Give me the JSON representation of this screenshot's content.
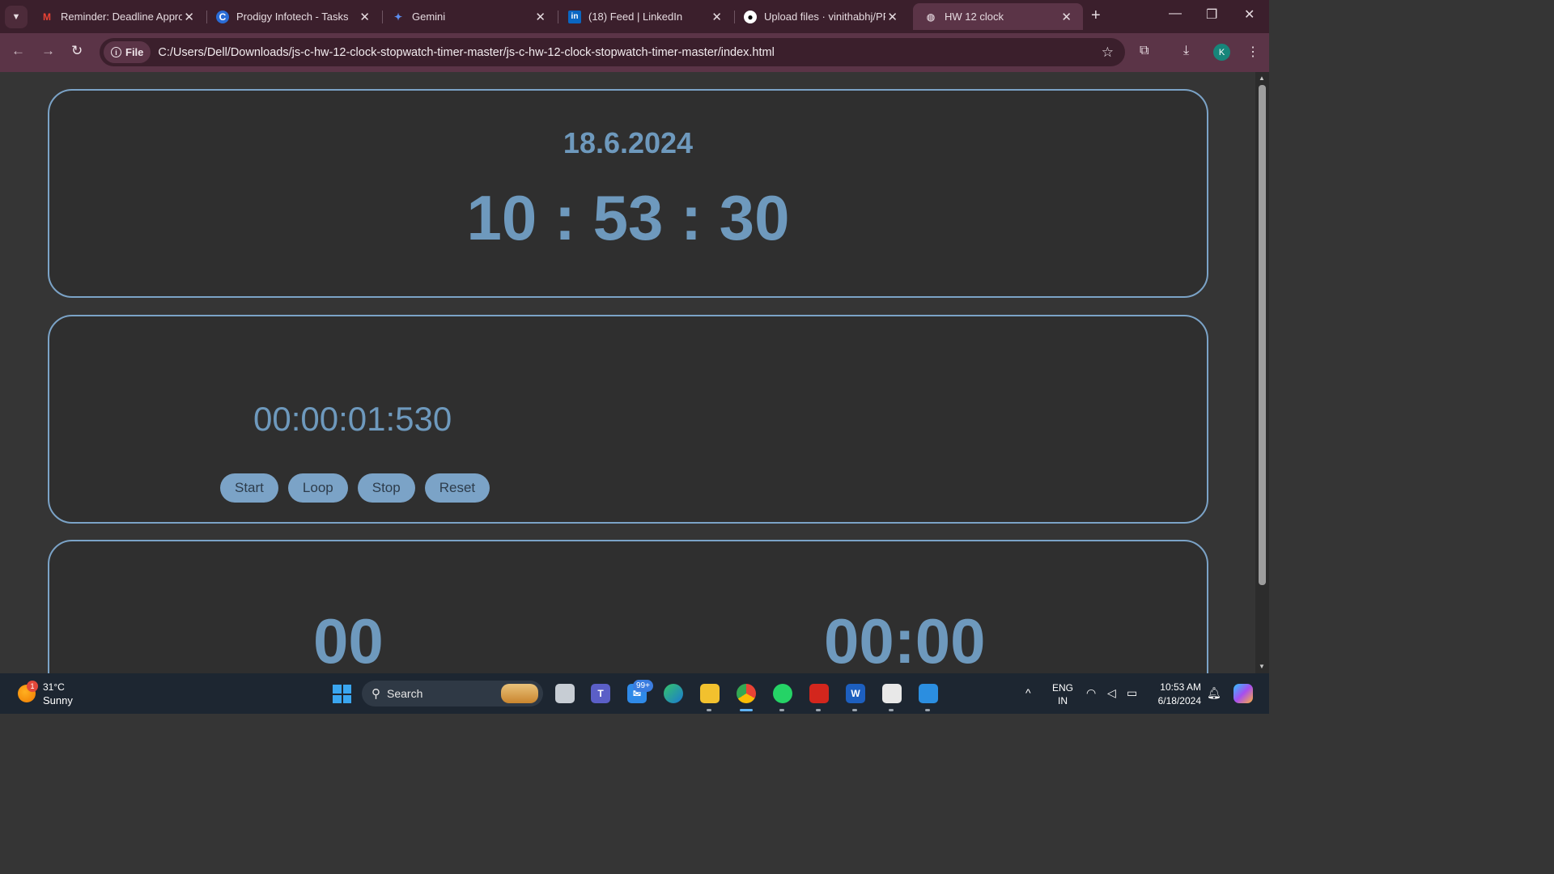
{
  "browser": {
    "tabs": [
      {
        "title": "Reminder: Deadline Appro",
        "favicon": "gmail-icon",
        "active": false
      },
      {
        "title": "Prodigy Infotech - Tasks",
        "favicon": "prodigy-icon",
        "active": false
      },
      {
        "title": "Gemini",
        "favicon": "gemini-icon",
        "active": false
      },
      {
        "title": "(18) Feed | LinkedIn",
        "favicon": "linkedin-icon",
        "active": false
      },
      {
        "title": "Upload files · vinithabhj/PR",
        "favicon": "github-icon",
        "active": false
      },
      {
        "title": "HW 12 clock",
        "favicon": "globe-icon",
        "active": true
      }
    ],
    "address": {
      "scheme_chip": "File",
      "url": "C:/Users/Dell/Downloads/js-c-hw-12-clock-stopwatch-timer-master/js-c-hw-12-clock-stopwatch-timer-master/index.html"
    },
    "profile_initial": "K"
  },
  "page": {
    "clock": {
      "date": "18.6.2024",
      "time": "10 : 53 : 30"
    },
    "stopwatch": {
      "display": "00:00:01:530",
      "buttons": {
        "start": "Start",
        "loop": "Loop",
        "stop": "Stop",
        "reset": "Reset"
      }
    },
    "timer": {
      "left_display": "00",
      "right_display": "00:00"
    },
    "colors": {
      "accent": "#7ba3c7",
      "text": "#6e99bd",
      "panel_bg": "#2f2f2f",
      "page_bg": "#353535"
    }
  },
  "taskbar": {
    "weather": {
      "temp": "31°C",
      "condition": "Sunny",
      "badge": "1"
    },
    "search_label": "Search",
    "mail_badge": "99+",
    "language": {
      "line1": "ENG",
      "line2": "IN"
    },
    "clock": {
      "time": "10:53 AM",
      "date": "6/18/2024"
    }
  }
}
